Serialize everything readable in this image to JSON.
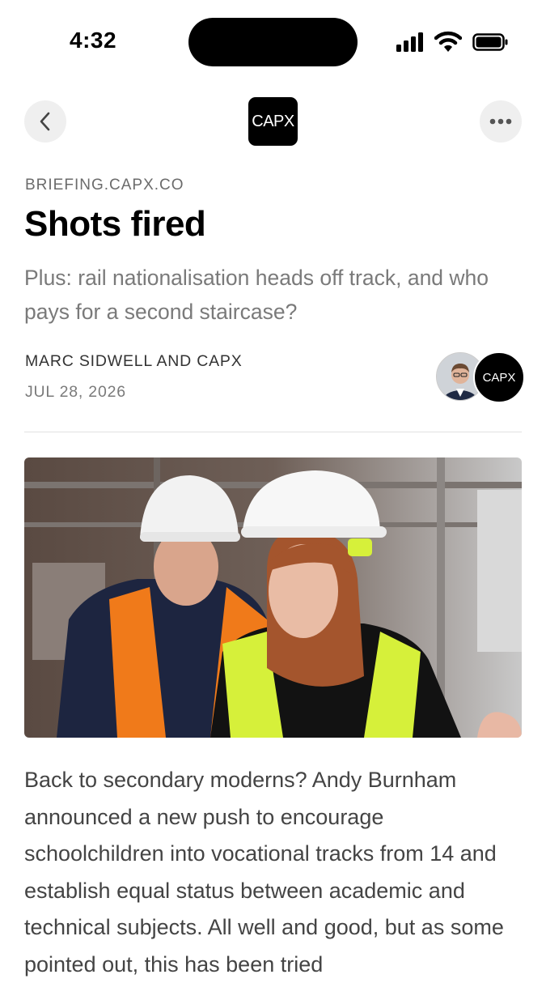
{
  "status_bar": {
    "time": "4:32",
    "icons": [
      "cellular-signal-icon",
      "wifi-icon",
      "battery-icon"
    ]
  },
  "nav": {
    "back_icon": "chevron-left-icon",
    "more_icon": "ellipsis-icon",
    "publication_logo_text": "CAPX"
  },
  "article": {
    "source": "BRIEFING.CAPX.CO",
    "title": "Shots fired",
    "subtitle": "Plus: rail nationalisation heads off track, and who pays for a second staircase?",
    "author": "MARC SIDWELL AND CAPX",
    "date": "JUL 28, 2026",
    "author_avatar_badge": "CAPX",
    "body": "Back to secondary moderns? Andy Burnham announced a new push to encourage schoolchildren into vocational tracks from 14 and establish equal status between academic and technical subjects. All well and good, but as some pointed out, this has been tried"
  },
  "colors": {
    "accent_dark": "#000000",
    "muted_text": "#7a7a7a",
    "button_bg": "#efefef"
  }
}
